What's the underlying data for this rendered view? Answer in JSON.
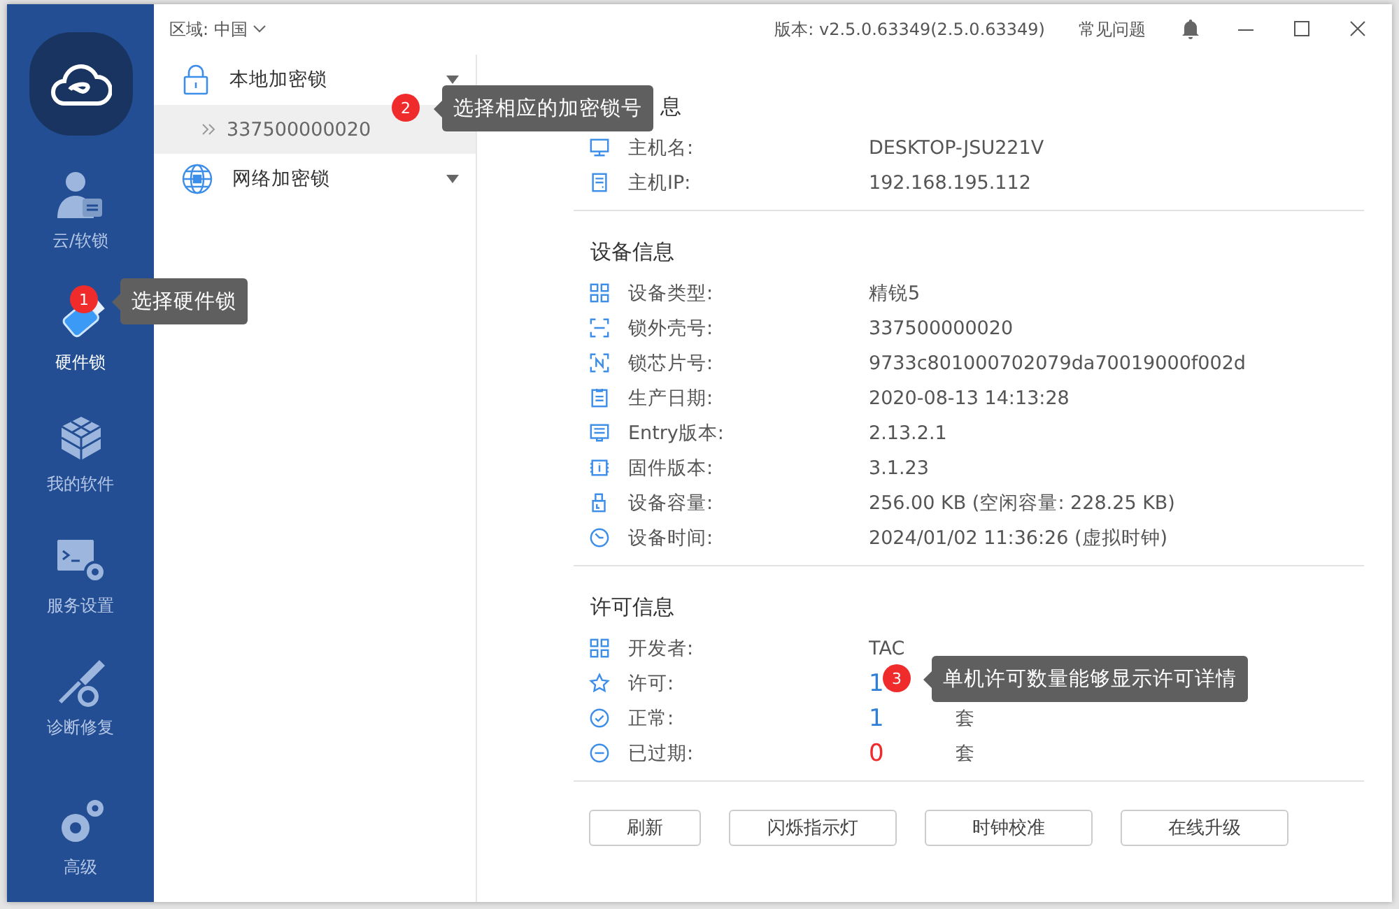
{
  "top_bar": {
    "region_label": "区域:",
    "region_value": "中国",
    "version": "版本: v2.5.0.63349(2.5.0.63349)",
    "faq": "常见问题"
  },
  "sidebar": {
    "items": [
      {
        "label": "云/软锁",
        "kind": "user",
        "selected": false
      },
      {
        "label": "硬件锁",
        "kind": "usb",
        "selected": true
      },
      {
        "label": "我的软件",
        "kind": "cubes",
        "selected": false
      },
      {
        "label": "服务设置",
        "kind": "terminal",
        "selected": false
      },
      {
        "label": "诊断修复",
        "kind": "tools",
        "selected": false
      },
      {
        "label": "高级",
        "kind": "gears",
        "selected": false
      }
    ]
  },
  "tree": [
    {
      "label": "本地加密锁",
      "kind": "lock",
      "children": [
        {
          "label": "337500000020",
          "selected": true
        }
      ]
    },
    {
      "label": "网络加密锁",
      "kind": "globe"
    }
  ],
  "sections": [
    {
      "title": "息",
      "rows": [
        {
          "kind": "monitor",
          "label": "主机名:",
          "value": "DESKTOP-JSU221V"
        },
        {
          "kind": "server",
          "label": "主机IP:",
          "value": "192.168.195.112"
        }
      ]
    },
    {
      "title": "设备信息",
      "rows": [
        {
          "kind": "grid",
          "label": "设备类型:",
          "value": "精锐5"
        },
        {
          "kind": "frame",
          "label": "锁外壳号:",
          "value": "337500000020"
        },
        {
          "kind": "chip-n",
          "label": "锁芯片号:",
          "value": "9733c801000702079da70019000f002d"
        },
        {
          "kind": "clipboard",
          "label": "生产日期:",
          "value": "2020-08-13 14:13:28"
        },
        {
          "kind": "doc",
          "label": "Entry版本:",
          "value": "2.13.2.1"
        },
        {
          "kind": "chip",
          "label": "固件版本:",
          "value": "3.1.23"
        },
        {
          "kind": "usb",
          "label": "设备容量:",
          "value": "256.00 KB  (空闲容量: 228.25 KB)"
        },
        {
          "kind": "clock",
          "label": "设备时间:",
          "value": "2024/01/02 11:36:26 (虚拟时钟)"
        }
      ]
    },
    {
      "title": "许可信息",
      "rows": [
        {
          "kind": "grid",
          "label": "开发者:",
          "value": "TAC"
        },
        {
          "kind": "star",
          "label": "许可:",
          "value": "1",
          "color": "#2f7fd8"
        },
        {
          "kind": "check",
          "label": "正常:",
          "value": "1",
          "color": "#2f7fd8",
          "unit": "套"
        },
        {
          "kind": "minus",
          "label": "已过期:",
          "value": "0",
          "color": "#f02b2b",
          "unit": "套"
        }
      ]
    }
  ],
  "buttons": [
    "刷新",
    "闪烁指示灯",
    "时钟校准",
    "在线升级"
  ],
  "callouts": [
    {
      "number": "1",
      "text": "选择硬件锁"
    },
    {
      "number": "2",
      "text": "选择相应的加密锁号"
    },
    {
      "number": "3",
      "text": "单机许可数量能够显示许可详情"
    }
  ]
}
